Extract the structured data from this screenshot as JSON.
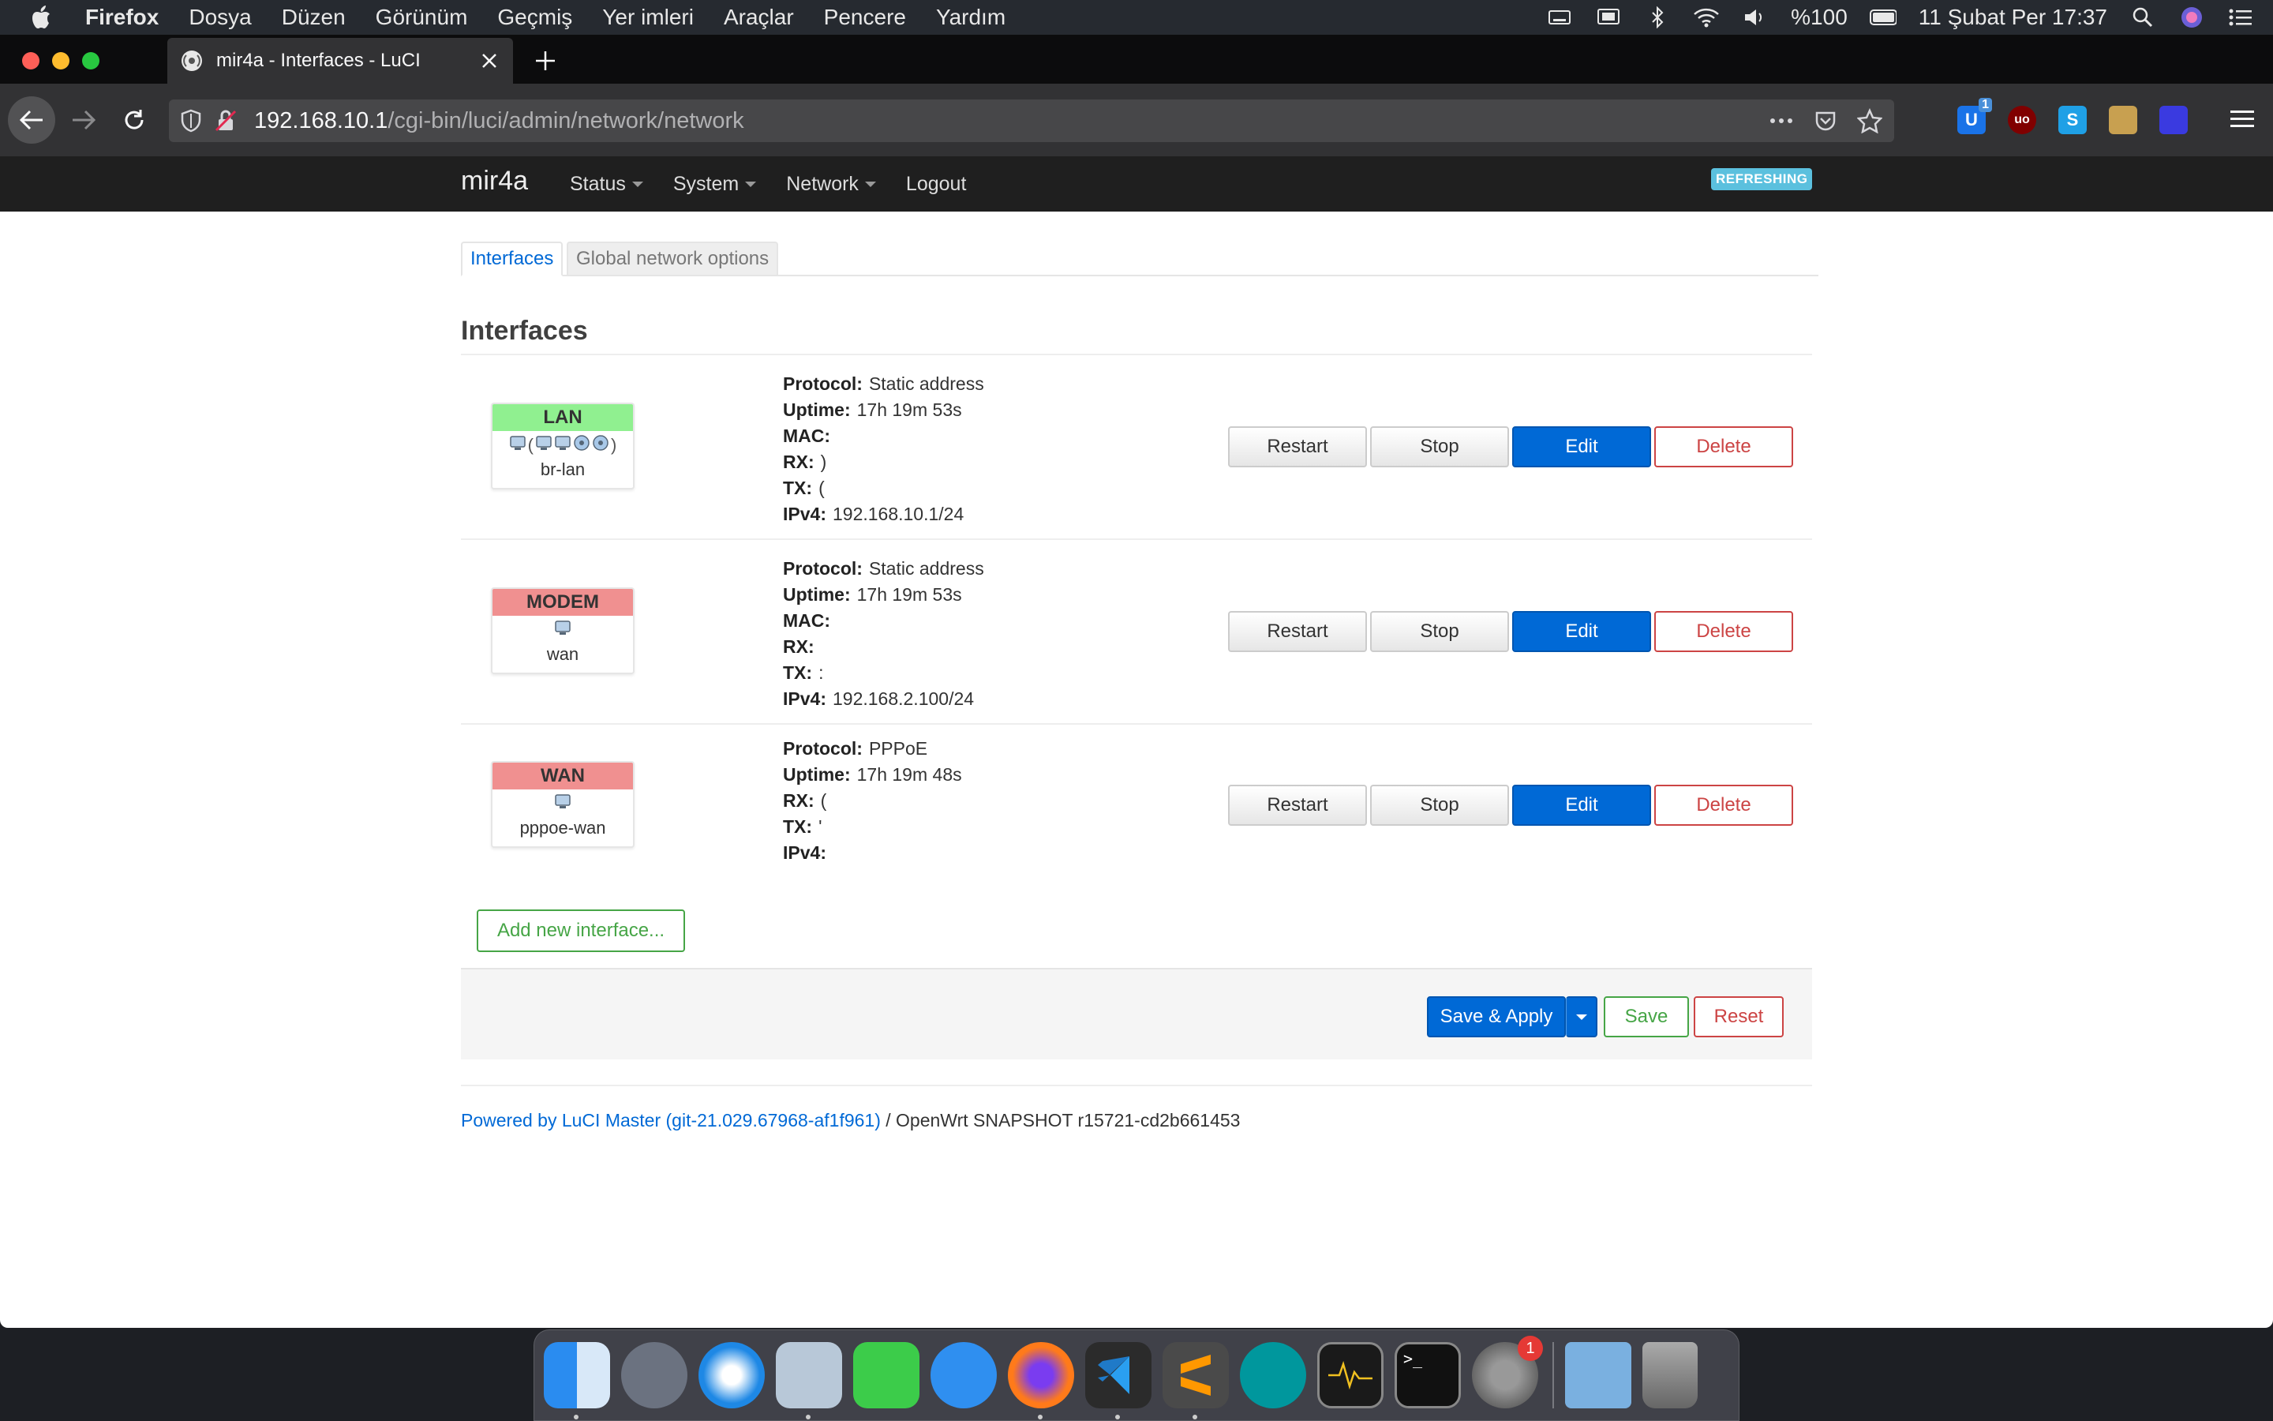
{
  "menubar": {
    "app_name": "Firefox",
    "menus": [
      "Dosya",
      "Düzen",
      "Görünüm",
      "Geçmiş",
      "Yer imleri",
      "Araçlar",
      "Pencere",
      "Yardım"
    ],
    "battery_text": "%100",
    "datetime": "11 Şubat Per  17:37"
  },
  "browser": {
    "tab_title": "mir4a - Interfaces - LuCI",
    "url_host": "192.168.10.1",
    "url_path": "/cgi-bin/luci/admin/network/network",
    "ext_badge": "1"
  },
  "luci": {
    "brand": "mir4a",
    "nav": [
      "Status",
      "System",
      "Network",
      "Logout"
    ],
    "refreshing": "REFRESHING",
    "tabs": [
      "Interfaces",
      "Global network options"
    ],
    "section_title": "Interfaces",
    "interfaces": [
      {
        "name": "LAN",
        "header_color": "#90f090",
        "icons": "(  )",
        "device": "br-lan",
        "fields": [
          {
            "label": "Protocol:",
            "value": "Static address"
          },
          {
            "label": "Uptime:",
            "value": "17h 19m 53s"
          },
          {
            "label": "MAC:",
            "value": ""
          },
          {
            "label": "RX:",
            "value": ")"
          },
          {
            "label": "TX:",
            "value": "("
          },
          {
            "label": "IPv4:",
            "value": "192.168.10.1/24"
          }
        ]
      },
      {
        "name": "MODEM",
        "header_color": "#f09090",
        "icons": "",
        "device": "wan",
        "fields": [
          {
            "label": "Protocol:",
            "value": "Static address"
          },
          {
            "label": "Uptime:",
            "value": "17h 19m 53s"
          },
          {
            "label": "MAC:",
            "value": ""
          },
          {
            "label": "RX:",
            "value": ""
          },
          {
            "label": "TX:",
            "value": ":"
          },
          {
            "label": "IPv4:",
            "value": "192.168.2.100/24"
          }
        ]
      },
      {
        "name": "WAN",
        "header_color": "#f09090",
        "icons": "",
        "device": "pppoe-wan",
        "fields": [
          {
            "label": "Protocol:",
            "value": "PPPoE"
          },
          {
            "label": "Uptime:",
            "value": "17h 19m 48s"
          },
          {
            "label": "RX:",
            "value": "("
          },
          {
            "label": "TX:",
            "value": "'"
          },
          {
            "label": "IPv4:",
            "value": ""
          }
        ]
      }
    ],
    "row_buttons": {
      "restart": "Restart",
      "stop": "Stop",
      "edit": "Edit",
      "delete": "Delete"
    },
    "add_interface": "Add new interface...",
    "save_apply": "Save & Apply",
    "save": "Save",
    "reset": "Reset",
    "footer_link": "Powered by LuCI Master (git-21.029.67968-af1f961)",
    "footer_rest": " / OpenWrt SNAPSHOT r15721-cd2b661453"
  },
  "dock": {
    "apps": [
      "finder-icon",
      "launchpad-icon",
      "safari-icon",
      "preview-icon",
      "facetime-icon",
      "messages-icon",
      "firefox-icon",
      "vscode-icon",
      "sublime-icon",
      "arduino-icon",
      "activity-monitor-icon",
      "terminal-icon",
      "system-preferences-icon"
    ],
    "sysprefs_badge": "1"
  }
}
